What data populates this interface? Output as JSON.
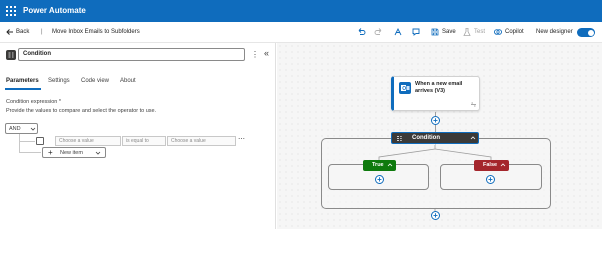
{
  "app": {
    "title": "Power Automate"
  },
  "command_bar": {
    "back_label": "Back",
    "flow_name": "Move Inbox Emails to Subfolders",
    "save_label": "Save",
    "test_label": "Test",
    "copilot_label": "Copilot",
    "new_designer_label": "New designer",
    "new_designer_on": true
  },
  "panel": {
    "action_name": "Condition",
    "tabs": [
      "Parameters",
      "Settings",
      "Code view",
      "About"
    ],
    "active_tab": "Parameters",
    "condition_label": "Condition expression *",
    "instruction": "Provide the values to compare and select the operator to use.",
    "group_operator": "AND",
    "row": {
      "left_placeholder": "Choose a value",
      "operator": "is equal to",
      "right_placeholder": "Choose a value"
    },
    "new_item_label": "New item"
  },
  "canvas": {
    "trigger_title": "When a new email arrives (V3)",
    "condition_title": "Condition",
    "true_label": "True",
    "false_label": "False"
  },
  "colors": {
    "brand": "#0f6cbd",
    "condition_header": "#3b3a39",
    "true_branch": "#0e7a0d",
    "false_branch": "#a4262c",
    "outlook_icon": "#0f6cbd"
  }
}
